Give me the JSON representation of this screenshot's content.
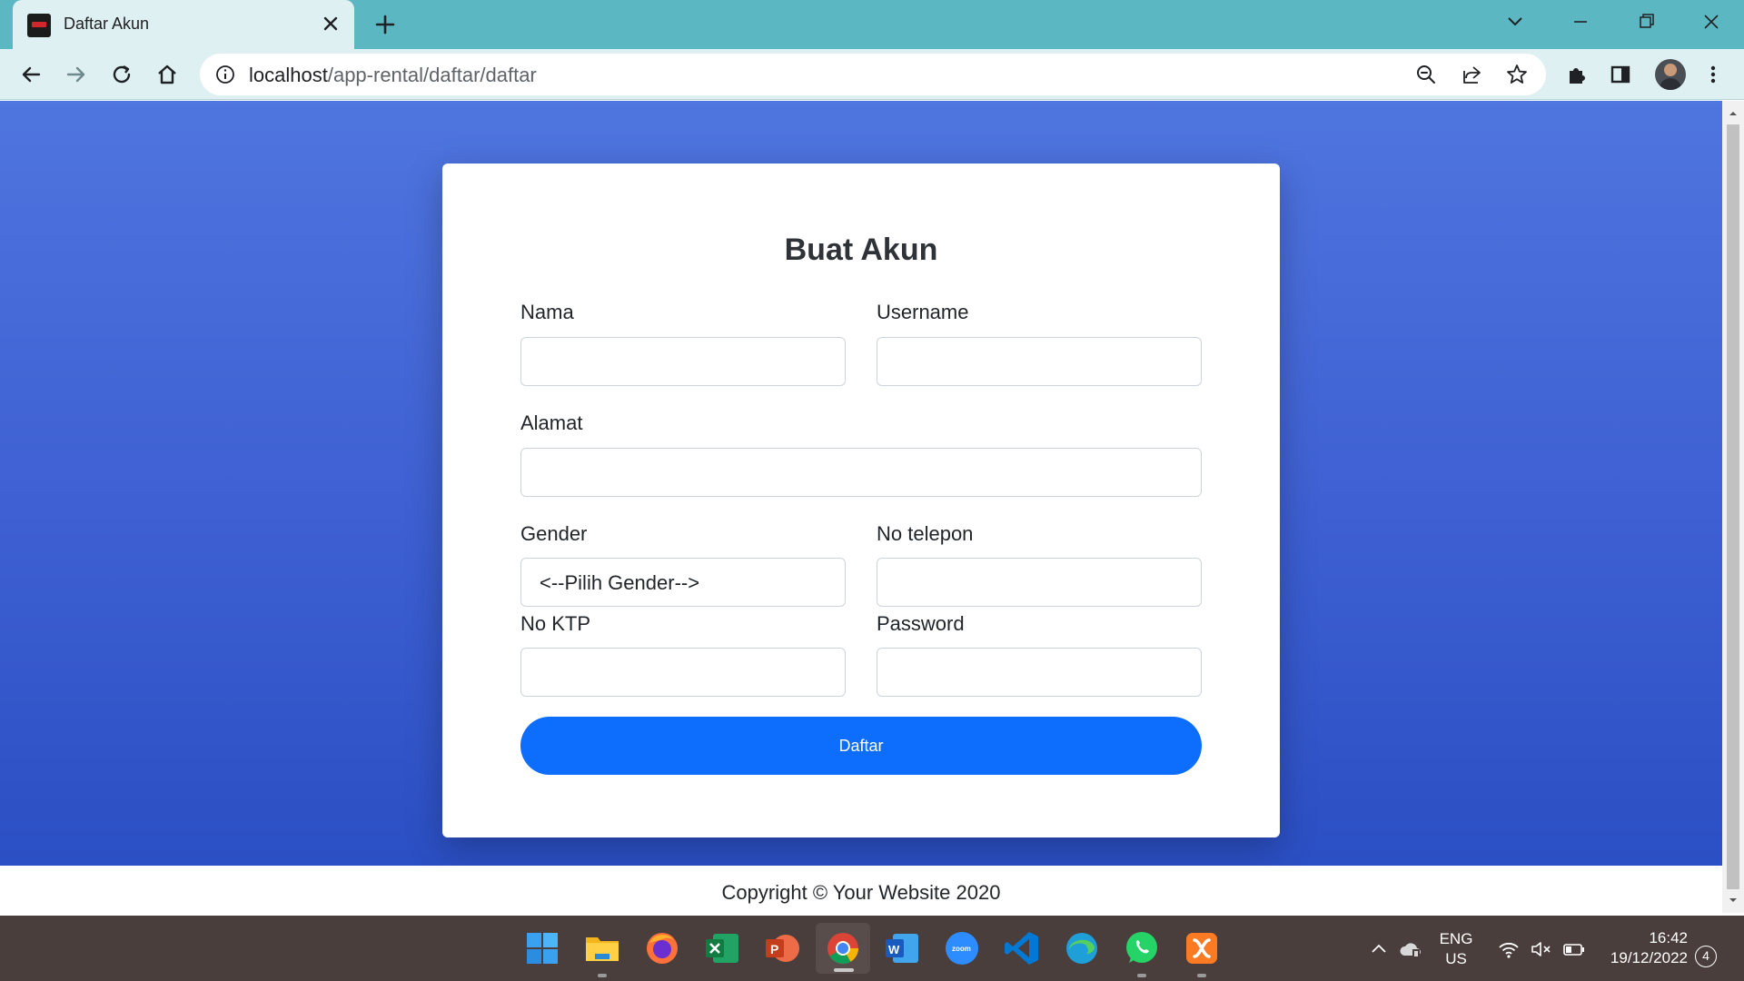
{
  "browser": {
    "tab_title": "Daftar Akun",
    "url_host": "localhost",
    "url_path": "/app-rental/daftar/daftar"
  },
  "form": {
    "title": "Buat Akun",
    "fields": {
      "nama_label": "Nama",
      "username_label": "Username",
      "alamat_label": "Alamat",
      "gender_label": "Gender",
      "gender_selected": "<--Pilih Gender-->",
      "telepon_label": "No telepon",
      "ktp_label": "No KTP",
      "password_label": "Password"
    },
    "submit_label": "Daftar"
  },
  "footer": {
    "copyright": "Copyright © Your Website 2020"
  },
  "taskbar": {
    "apps": [
      "start",
      "file-explorer",
      "firefox",
      "excel",
      "powerpoint",
      "chrome",
      "word",
      "zoom",
      "vscode",
      "edge",
      "whatsapp",
      "xampp"
    ],
    "lang_top": "ENG",
    "lang_bottom": "US",
    "time": "16:42",
    "date": "19/12/2022",
    "notification_count": "4"
  },
  "colors": {
    "primary": "#0d6efd",
    "bg_top": "#4f75df",
    "bg_bottom": "#2b4fc4",
    "chrome": "#5bb8c2"
  }
}
